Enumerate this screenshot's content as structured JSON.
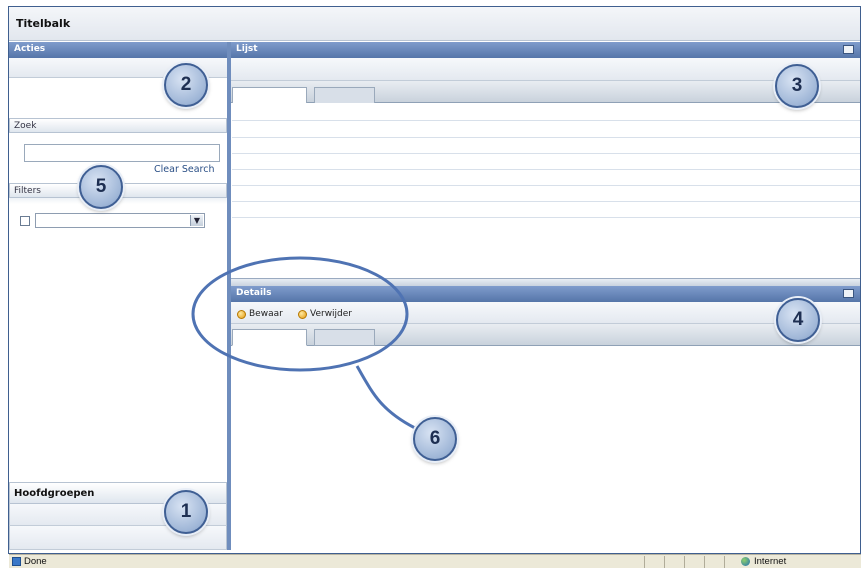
{
  "titlebar": {
    "title": "Titelbalk"
  },
  "sidebar": {
    "actions_header": "Acties",
    "search_header": "Zoek",
    "search_value": "",
    "clear_search": "Clear Search",
    "filters_header": "Filters",
    "filter_checked": false,
    "filter_select_value": "",
    "groups_header": "Hoofdgroepen"
  },
  "list_panel": {
    "header": "Lijst",
    "tabs": [
      "",
      ""
    ]
  },
  "details_panel": {
    "header": "Details",
    "save_label": "Bewaar",
    "delete_label": "Verwijder",
    "tabs": [
      "",
      ""
    ]
  },
  "callouts": {
    "c1": "1",
    "c2": "2",
    "c3": "3",
    "c4": "4",
    "c5": "5",
    "c6": "6"
  },
  "statusbar": {
    "left_text": "Done",
    "zone_text": "Internet"
  },
  "icons": {
    "save": "save-icon",
    "delete": "delete-icon",
    "status_page": "page-icon",
    "status_zone": "globe-icon"
  },
  "colors": {
    "header_blue": "#5575a9",
    "callout_fill": "#9fb6d7",
    "callout_border": "#3f5f94",
    "annotation_ring": "#4f73b3"
  }
}
